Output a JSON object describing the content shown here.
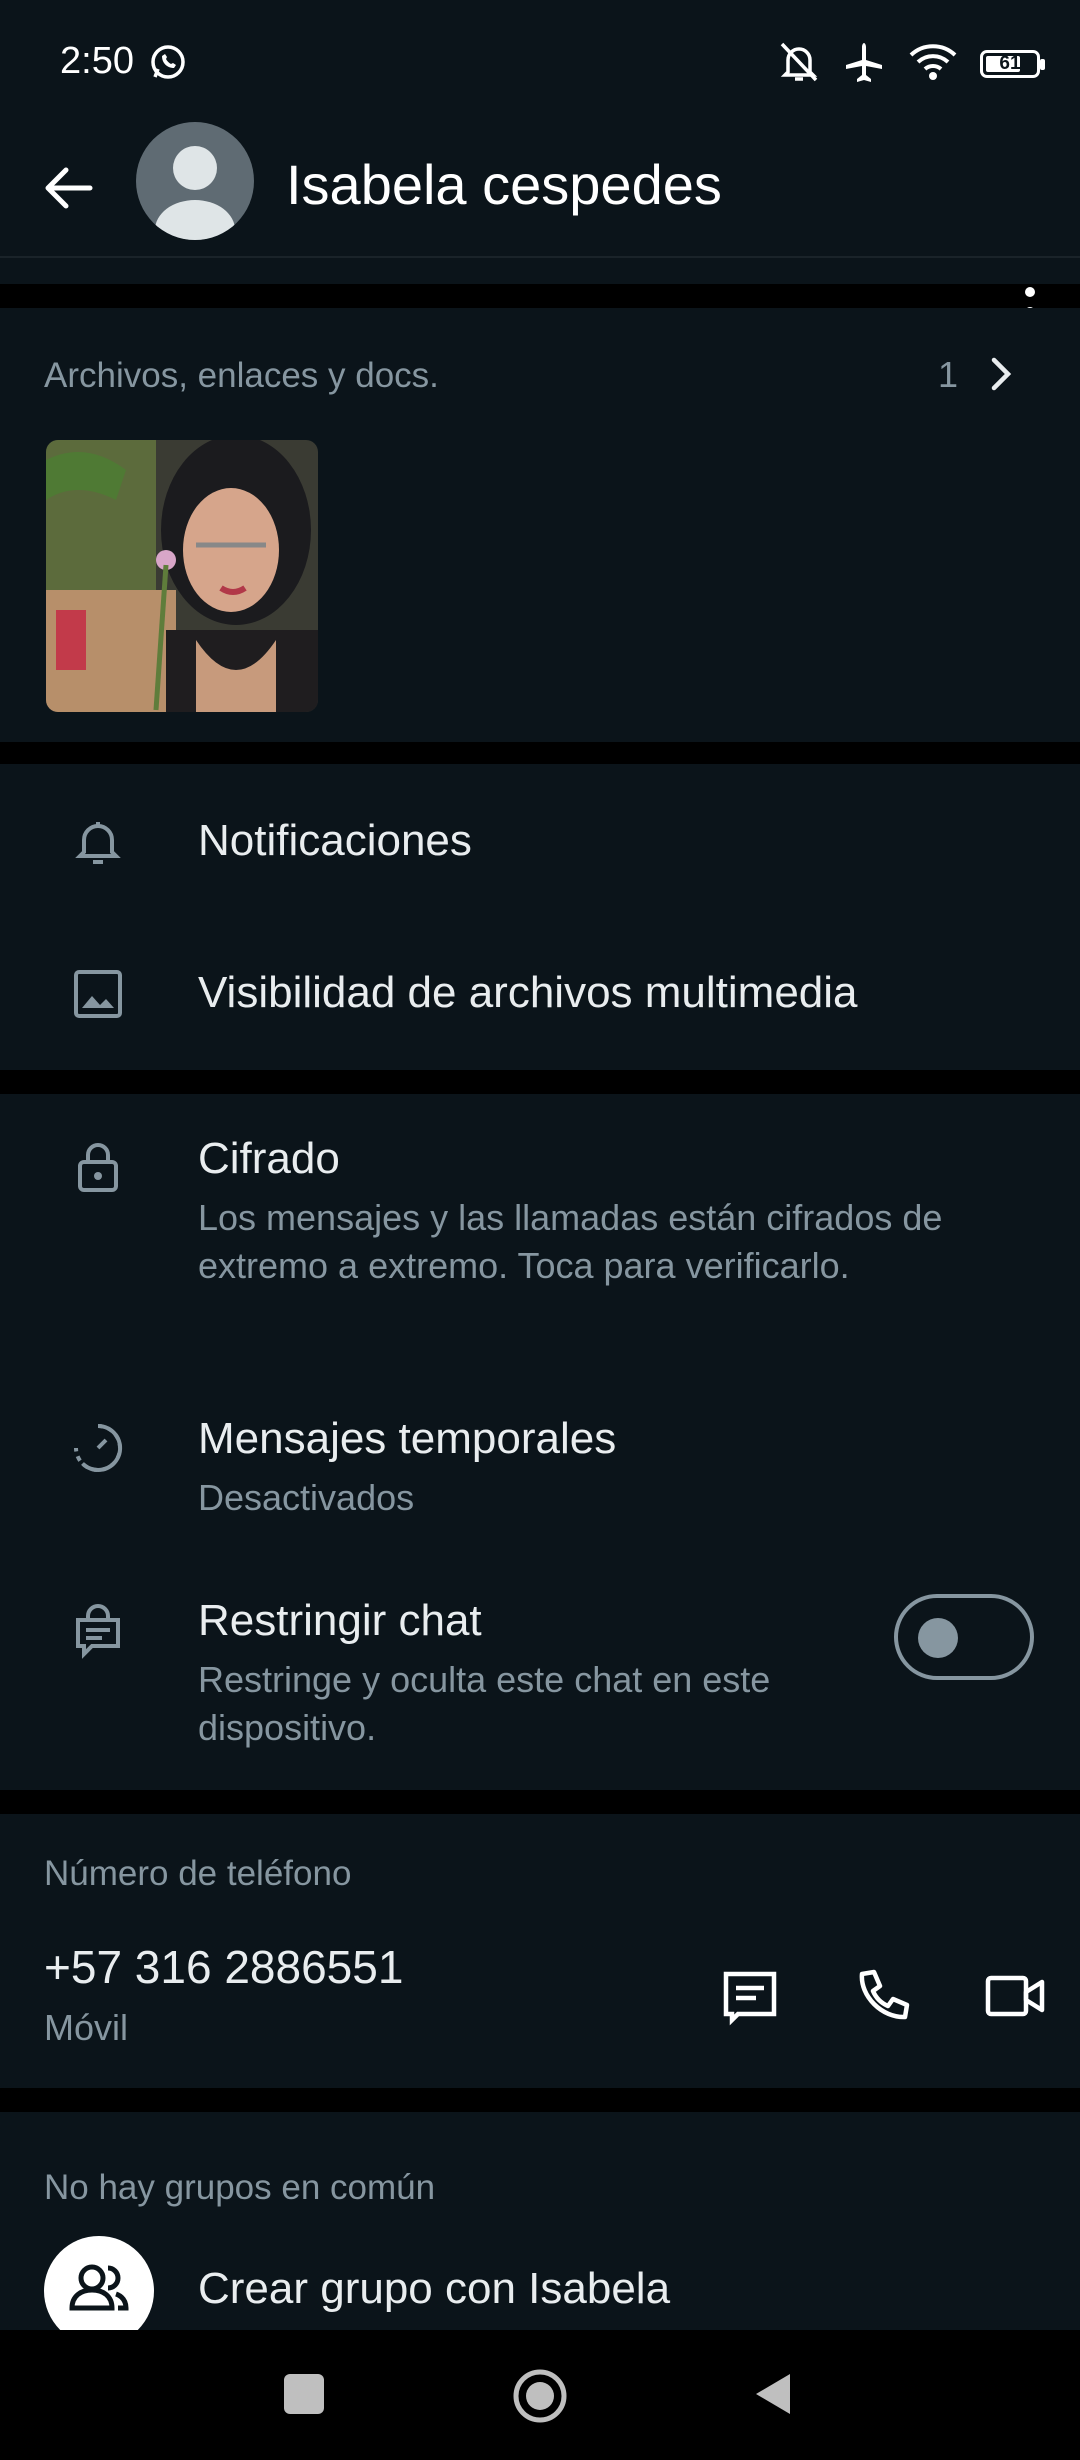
{
  "status_bar": {
    "time": "2:50",
    "battery": "61"
  },
  "header": {
    "name": "Isabela cespedes"
  },
  "media": {
    "title": "Archivos, enlaces y docs.",
    "count": "1"
  },
  "settings": {
    "notifications": "Notificaciones",
    "media_visibility": "Visibilidad de archivos multimedia"
  },
  "privacy": {
    "encryption_title": "Cifrado",
    "encryption_desc": "Los mensajes y las llamadas están cifrados de extremo a extremo. Toca para verificarlo.",
    "temp_title": "Mensajes temporales",
    "temp_desc": "Desactivados",
    "restrict_title": "Restringir chat",
    "restrict_desc": "Restringe y oculta este chat en este dispositivo."
  },
  "phone": {
    "label": "Número de teléfono",
    "number": "+57 316 2886551",
    "type": "Móvil"
  },
  "groups": {
    "label": "No hay grupos en común",
    "create": "Crear grupo con Isabela"
  },
  "colors": {
    "panel": "#0b141a",
    "text": "#e9edef",
    "muted": "#8696a0"
  }
}
